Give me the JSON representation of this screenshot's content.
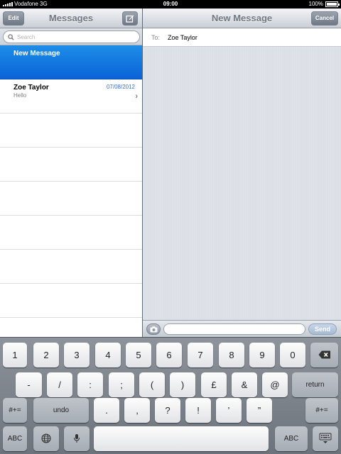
{
  "status_bar": {
    "carrier": "Vodafone 3G",
    "time": "09:00",
    "battery": "100%"
  },
  "left_pane": {
    "edit_label": "Edit",
    "title": "Messages",
    "search_placeholder": "Search",
    "items": [
      {
        "name": "New Message",
        "date": "",
        "preview": "",
        "selected": true
      },
      {
        "name": "Zoe Taylor",
        "date": "07/08/2012",
        "preview": "Hello",
        "selected": false
      }
    ]
  },
  "right_pane": {
    "title": "New Message",
    "cancel_label": "Cancel",
    "to_label": "To:",
    "to_value": "Zoe Taylor",
    "send_label": "Send",
    "message_value": ""
  },
  "keyboard": {
    "row1": [
      "1",
      "2",
      "3",
      "4",
      "5",
      "6",
      "7",
      "8",
      "9",
      "0"
    ],
    "row2": [
      "-",
      "/",
      ":",
      ";",
      "(",
      ")",
      "£",
      "&",
      "@"
    ],
    "return_label": "return",
    "row3_left": "#+=",
    "undo_label": "undo",
    "row3": [
      ".",
      ",",
      "?",
      "!",
      "’",
      "”"
    ],
    "row3_right": "#+=",
    "abc_left": "ABC",
    "abc_right": "ABC"
  },
  "icons": {
    "search": "search-icon",
    "compose": "compose-icon",
    "camera": "camera-icon",
    "backspace": "backspace-icon",
    "globe": "globe-icon",
    "mic": "microphone-icon",
    "hide_keyboard": "hide-keyboard-icon"
  }
}
